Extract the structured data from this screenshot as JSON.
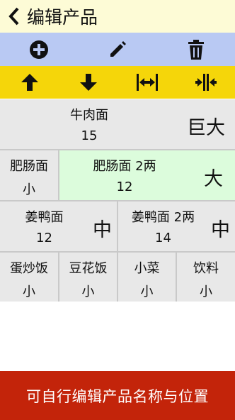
{
  "header": {
    "back_icon": "chevron-left-icon",
    "title": "编辑产品"
  },
  "toolbar_top": [
    {
      "icon": "add-circle-icon"
    },
    {
      "icon": "pencil-icon"
    },
    {
      "icon": "trash-icon"
    }
  ],
  "toolbar_bottom": [
    {
      "icon": "arrow-up-icon"
    },
    {
      "icon": "arrow-down-icon"
    },
    {
      "icon": "expand-horizontal-icon"
    },
    {
      "icon": "shrink-horizontal-icon"
    }
  ],
  "products": [
    {
      "name": "牛肉面",
      "qty": "15",
      "size": "巨大"
    },
    {
      "name": "肥肠面",
      "qty": "小",
      "size": ""
    },
    {
      "name": "肥肠面 2两",
      "qty": "12",
      "size": "大"
    },
    {
      "name": "姜鸭面",
      "qty": "12",
      "size": "中"
    },
    {
      "name": "姜鸭面 2两",
      "qty": "14",
      "size": "中"
    },
    {
      "name": "蛋炒饭",
      "qty": "小",
      "size": ""
    },
    {
      "name": "豆花饭",
      "qty": "小",
      "size": ""
    },
    {
      "name": "小菜",
      "qty": "小",
      "size": ""
    },
    {
      "name": "饮料",
      "qty": "小",
      "size": ""
    }
  ],
  "colors": {
    "header_bg": "#fdfbd6",
    "toolbar_top_bg": "#b9c9f3",
    "toolbar_bottom_bg": "#f5d60a",
    "cell_bg": "#e8e8e8",
    "selected_cell_bg": "#dcfcdc",
    "banner_bg": "#c3240a"
  },
  "banner": {
    "text": "可自行编辑产品名称与位置"
  }
}
